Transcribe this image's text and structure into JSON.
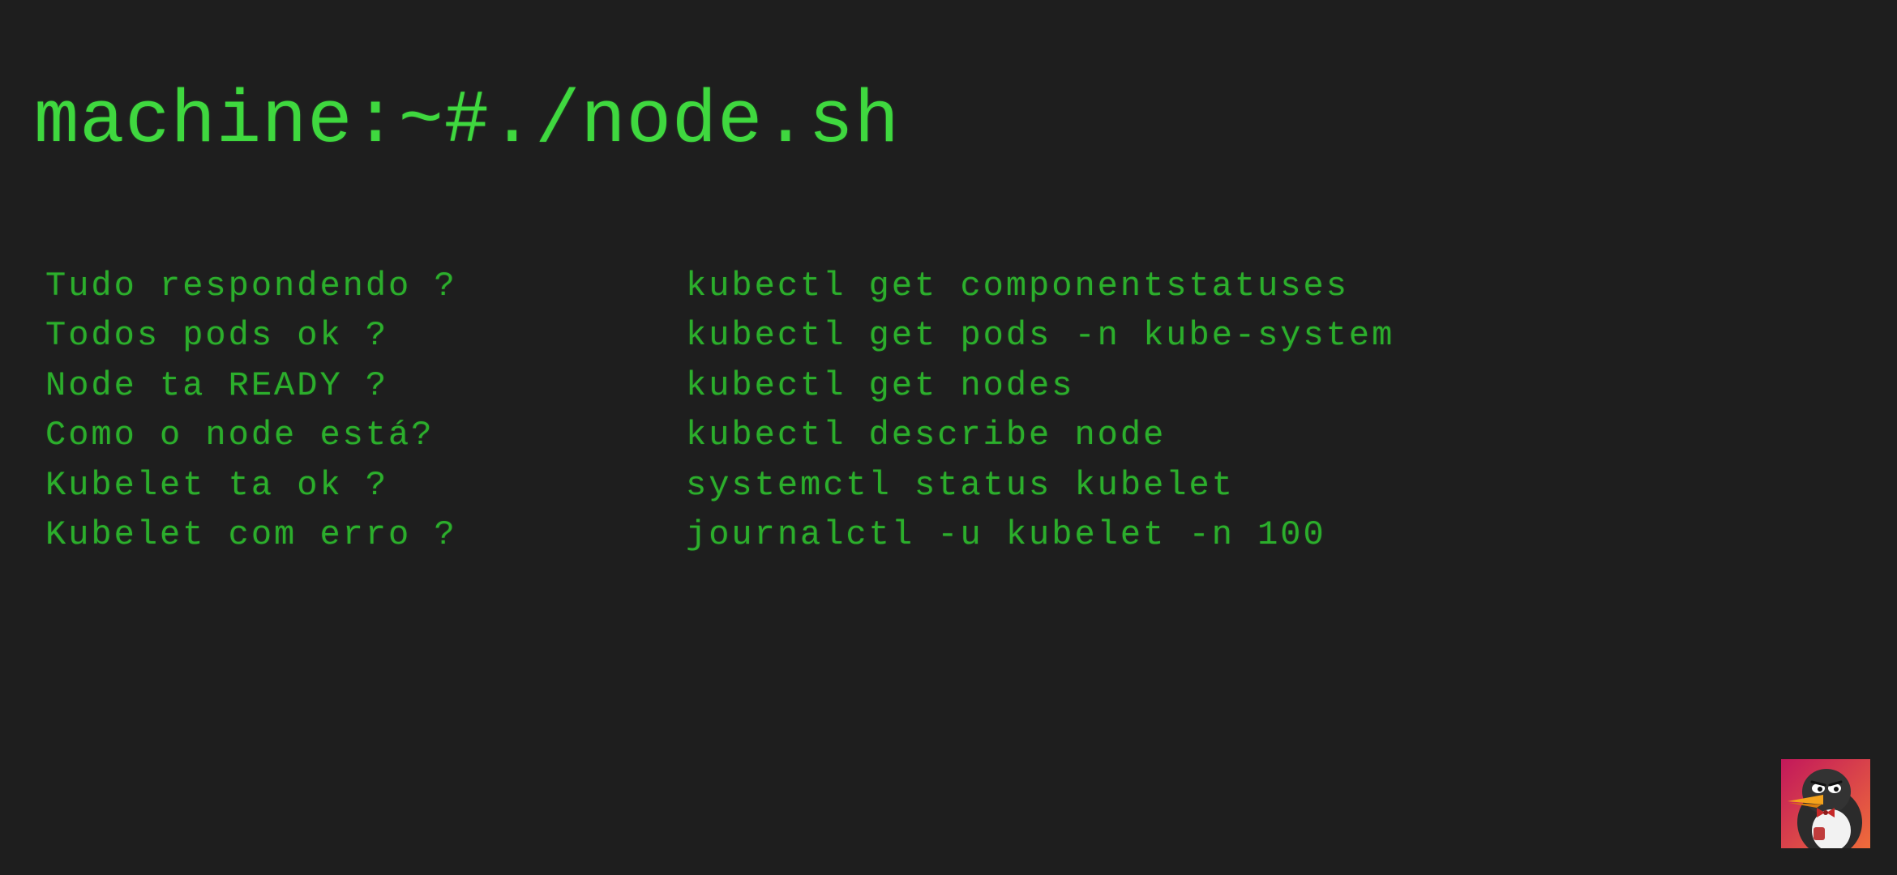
{
  "terminal": {
    "prompt": "machine:~#./node.sh",
    "rows": [
      {
        "question": "Tudo respondendo ?",
        "command": "kubectl get componentstatuses"
      },
      {
        "question": "Todos pods ok ?",
        "command": "kubectl get pods -n kube-system"
      },
      {
        "question": "Node ta READY ?",
        "command": "kubectl get nodes"
      },
      {
        "question": "Como o node está?",
        "command": "kubectl describe node"
      },
      {
        "question": "Kubelet ta ok ?",
        "command": "systemctl status kubelet"
      },
      {
        "question": "Kubelet com erro ?",
        "command": "journalctl -u kubelet -n 100"
      }
    ]
  },
  "colors": {
    "background": "#1e1e1e",
    "prompt_text": "#3fd83f",
    "body_text": "#2cae2c",
    "avatar_gradient_start": "#c2185b",
    "avatar_gradient_end": "#ef6c3a"
  },
  "avatar": {
    "icon": "penguin-mascot-icon"
  }
}
